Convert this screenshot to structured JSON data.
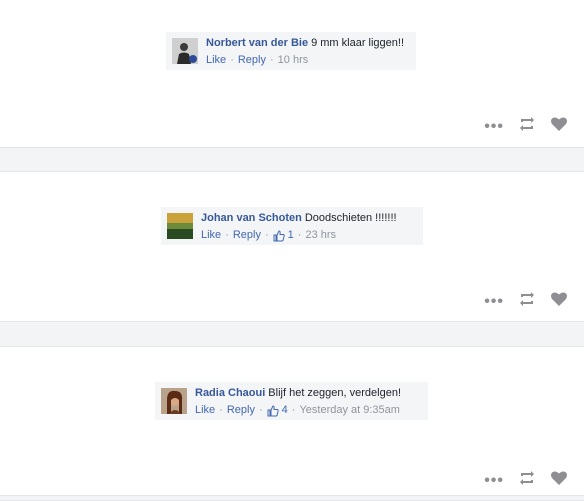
{
  "comments": [
    {
      "author": "Norbert van der Bie",
      "text": "9 mm klaar liggen!!",
      "like_label": "Like",
      "reply_label": "Reply",
      "likes": "",
      "time": "10 hrs",
      "avatar_icon": "person-photo"
    },
    {
      "author": "Johan van Schoten",
      "text": "Doodschieten !!!!!!!",
      "like_label": "Like",
      "reply_label": "Reply",
      "likes": "1",
      "time": "23 hrs",
      "avatar_icon": "landscape-photo"
    },
    {
      "author": "Radia Chaoui",
      "text": "Blijf het zeggen, verdelgen!",
      "like_label": "Like",
      "reply_label": "Reply",
      "likes": "4",
      "time": "Yesterday at 9:35am",
      "avatar_icon": "woman-photo"
    }
  ],
  "post_actions": {
    "more_icon": "more-dots-icon",
    "retweet_icon": "retweet-icon",
    "like_icon": "heart-icon"
  },
  "colors": {
    "link": "#4267b2",
    "author": "#365899",
    "meta": "#90949c",
    "comment_bg": "#f4f5f7",
    "icon": "#8e8e93"
  }
}
